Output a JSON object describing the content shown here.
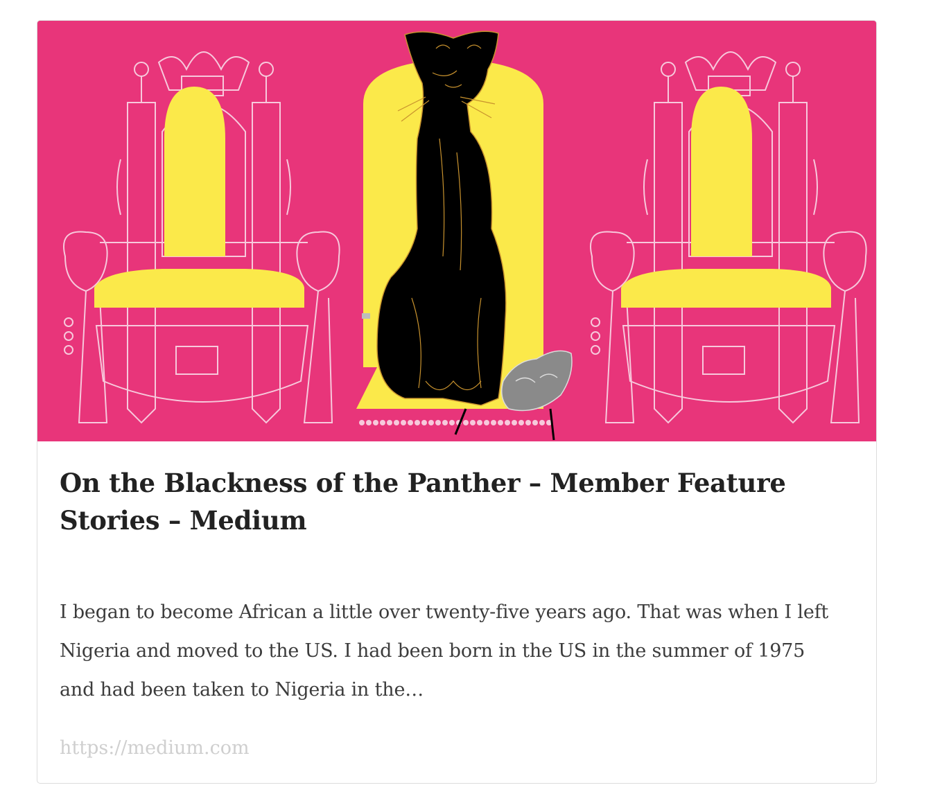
{
  "card": {
    "title": "On the Blackness of the Panther – Member Feature Stories – Medium",
    "description": "I began to become African a little over twenty-five years ago. That was when I left Nigeria and moved to the US. I had been born in the US in the summer of 1975 and had been taken to Nigeria in the…",
    "url": "https://medium.com"
  },
  "colors": {
    "background_pink": "#e8357a",
    "seat_yellow": "#fbe94a",
    "panther_black": "#000000",
    "outline_gold": "#c8922e",
    "throne_outline": "#f7c9dc",
    "mask_grey": "#8a8a8a"
  },
  "illustration": {
    "subject": "black panther seated on yellow throne between two pink outlined thrones"
  }
}
